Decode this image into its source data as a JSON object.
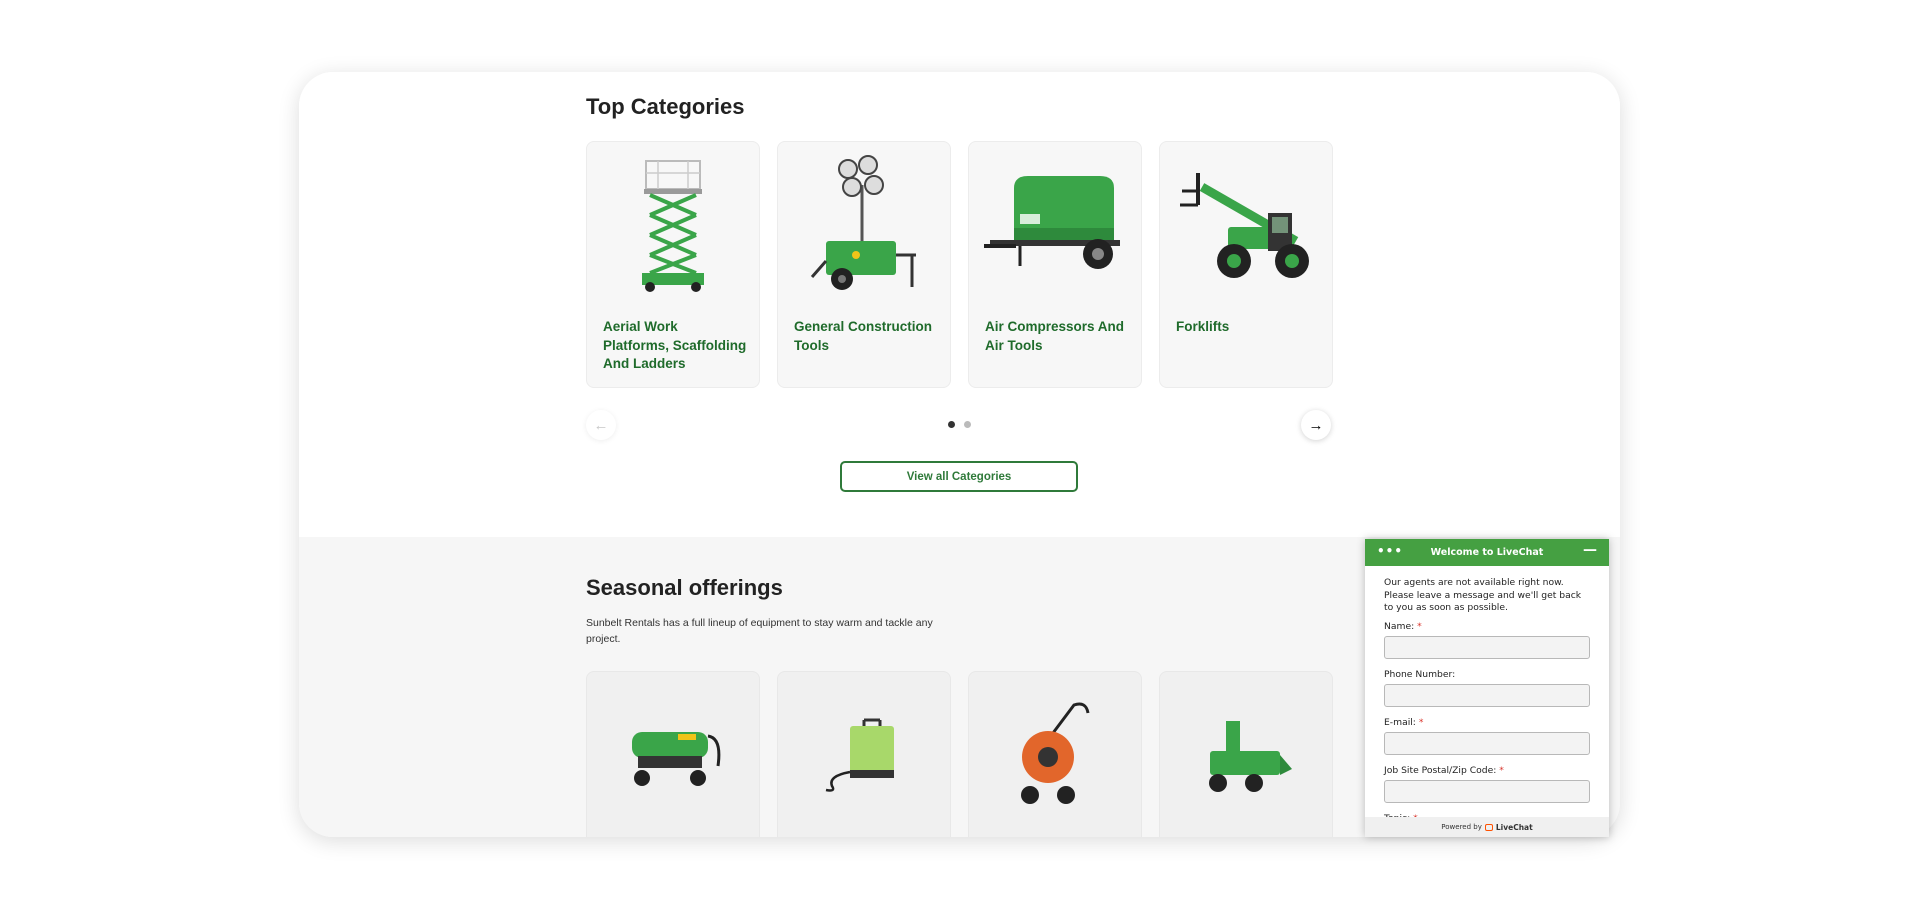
{
  "top_categories": {
    "title": "Top Categories",
    "cards": [
      {
        "label": "Aerial Work Platforms, Scaffolding And Ladders",
        "icon": "scissor-lift-icon"
      },
      {
        "label": "General Construction Tools",
        "icon": "light-tower-icon"
      },
      {
        "label": "Air Compressors And Air Tools",
        "icon": "air-compressor-icon"
      },
      {
        "label": "Forklifts",
        "icon": "telehandler-forklift-icon"
      }
    ],
    "prev_icon": "←",
    "next_icon": "→",
    "view_all_label": "View all Categories"
  },
  "seasonal": {
    "title": "Seasonal offerings",
    "description": "Sunbelt Rentals has a full lineup of equipment to stay warm and tackle any project."
  },
  "livechat": {
    "menu_icon": "•••",
    "title": "Welcome to LiveChat",
    "minimize_icon": "—",
    "message": "Our agents are not available right now. Please leave a message and we'll get back to you as soon as possible.",
    "fields": [
      {
        "label": "Name:",
        "required": "*"
      },
      {
        "label": "Phone Number:",
        "required": ""
      },
      {
        "label": "E-mail:",
        "required": "*"
      },
      {
        "label": "Job Site Postal/Zip Code:",
        "required": "*"
      }
    ],
    "topic_label": "Topic:",
    "topic_required": "*",
    "powered_by": "Powered by",
    "brand": "LiveChat"
  },
  "colors": {
    "brand_green": "#2f7a3a",
    "chat_green": "#45a042",
    "equipment_green": "#3aa549"
  }
}
